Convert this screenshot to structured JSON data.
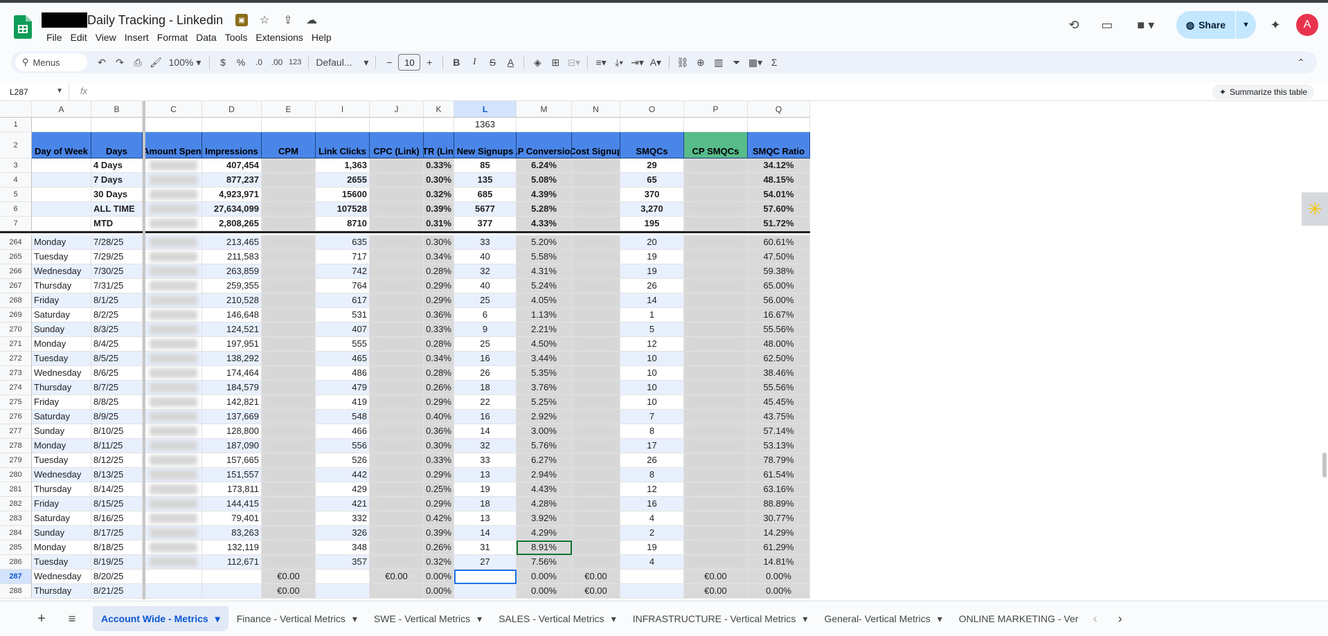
{
  "doc": {
    "title": "Daily Tracking - Linkedin"
  },
  "menu": [
    "File",
    "Edit",
    "View",
    "Insert",
    "Format",
    "Data",
    "Tools",
    "Extensions",
    "Help"
  ],
  "share": {
    "label": "Share"
  },
  "avatar": {
    "initial": "A"
  },
  "toolbar": {
    "search": "Menus",
    "zoom": "100%",
    "currency": "$",
    "percent": "%",
    "dec_dec": ".0",
    "dec_inc": ".00",
    "number_fmt": "123",
    "font": "Defaul...",
    "font_size": "10",
    "bold": "B",
    "italic": "I",
    "strike": "S",
    "textcolor": "A",
    "textformat": "A"
  },
  "formula": {
    "cell_ref": "L287",
    "fx": "fx",
    "summarize": "Summarize this table"
  },
  "columns": [
    "A",
    "B",
    "C",
    "D",
    "E",
    "I",
    "J",
    "K",
    "L",
    "M",
    "N",
    "O",
    "P",
    "Q"
  ],
  "frozen_rows": [
    {
      "num": "1",
      "cells": {
        "L": "1363"
      }
    },
    {
      "num": "2",
      "header": true,
      "cells": {
        "A": "Day of Week",
        "B": "Days",
        "C": "Amount Spent",
        "D": "Impressions",
        "E": "CPM",
        "I": "Link Clicks",
        "J": "CPC (Link)",
        "K": "CTR (Link)",
        "L": "New Signups",
        "M": "LP Conversion",
        "N": "Cost Signup",
        "O": "SMQCs",
        "P": "CP SMQCs",
        "Q": "SMQC Ratio"
      }
    },
    {
      "num": "3",
      "cells": {
        "B": "4 Days",
        "D": "407,454",
        "I": "1,363",
        "K": "0.33%",
        "L": "85",
        "M": "6.24%",
        "O": "29",
        "Q": "34.12%"
      }
    },
    {
      "num": "4",
      "cells": {
        "B": "7 Days",
        "D": "877,237",
        "I": "2655",
        "K": "0.30%",
        "L": "135",
        "M": "5.08%",
        "O": "65",
        "Q": "48.15%"
      }
    },
    {
      "num": "5",
      "cells": {
        "B": "30 Days",
        "D": "4,923,971",
        "I": "15600",
        "K": "0.32%",
        "L": "685",
        "M": "4.39%",
        "O": "370",
        "Q": "54.01%"
      }
    },
    {
      "num": "6",
      "cells": {
        "B": "ALL TIME",
        "D": "27,634,099",
        "I": "107528",
        "K": "0.39%",
        "L": "5677",
        "M": "5.28%",
        "O": "3,270",
        "Q": "57.60%"
      }
    },
    {
      "num": "7",
      "cells": {
        "B": "MTD",
        "D": "2,808,265",
        "I": "8710",
        "K": "0.31%",
        "L": "377",
        "M": "4.33%",
        "O": "195",
        "Q": "51.72%"
      }
    }
  ],
  "rows": [
    {
      "num": "264",
      "A": "Monday",
      "B": "7/28/25",
      "D": "213,465",
      "I": "635",
      "K": "0.30%",
      "L": "33",
      "M": "5.20%",
      "O": "20",
      "Q": "60.61%"
    },
    {
      "num": "265",
      "A": "Tuesday",
      "B": "7/29/25",
      "D": "211,583",
      "I": "717",
      "K": "0.34%",
      "L": "40",
      "M": "5.58%",
      "O": "19",
      "Q": "47.50%"
    },
    {
      "num": "266",
      "A": "Wednesday",
      "B": "7/30/25",
      "D": "263,859",
      "I": "742",
      "K": "0.28%",
      "L": "32",
      "M": "4.31%",
      "O": "19",
      "Q": "59.38%"
    },
    {
      "num": "267",
      "A": "Thursday",
      "B": "7/31/25",
      "D": "259,355",
      "I": "764",
      "K": "0.29%",
      "L": "40",
      "M": "5.24%",
      "O": "26",
      "Q": "65.00%"
    },
    {
      "num": "268",
      "A": "Friday",
      "B": "8/1/25",
      "D": "210,528",
      "I": "617",
      "K": "0.29%",
      "L": "25",
      "M": "4.05%",
      "O": "14",
      "Q": "56.00%"
    },
    {
      "num": "269",
      "A": "Saturday",
      "B": "8/2/25",
      "D": "146,648",
      "I": "531",
      "K": "0.36%",
      "L": "6",
      "M": "1.13%",
      "O": "1",
      "Q": "16.67%"
    },
    {
      "num": "270",
      "A": "Sunday",
      "B": "8/3/25",
      "D": "124,521",
      "I": "407",
      "K": "0.33%",
      "L": "9",
      "M": "2.21%",
      "O": "5",
      "Q": "55.56%"
    },
    {
      "num": "271",
      "A": "Monday",
      "B": "8/4/25",
      "D": "197,951",
      "I": "555",
      "K": "0.28%",
      "L": "25",
      "M": "4.50%",
      "O": "12",
      "Q": "48.00%"
    },
    {
      "num": "272",
      "A": "Tuesday",
      "B": "8/5/25",
      "D": "138,292",
      "I": "465",
      "K": "0.34%",
      "L": "16",
      "M": "3.44%",
      "O": "10",
      "Q": "62.50%"
    },
    {
      "num": "273",
      "A": "Wednesday",
      "B": "8/6/25",
      "D": "174,464",
      "I": "486",
      "K": "0.28%",
      "L": "26",
      "M": "5.35%",
      "O": "10",
      "Q": "38.46%"
    },
    {
      "num": "274",
      "A": "Thursday",
      "B": "8/7/25",
      "D": "184,579",
      "I": "479",
      "K": "0.26%",
      "L": "18",
      "M": "3.76%",
      "O": "10",
      "Q": "55.56%"
    },
    {
      "num": "275",
      "A": "Friday",
      "B": "8/8/25",
      "D": "142,821",
      "I": "419",
      "K": "0.29%",
      "L": "22",
      "M": "5.25%",
      "O": "10",
      "Q": "45.45%"
    },
    {
      "num": "276",
      "A": "Saturday",
      "B": "8/9/25",
      "D": "137,669",
      "I": "548",
      "K": "0.40%",
      "L": "16",
      "M": "2.92%",
      "O": "7",
      "Q": "43.75%"
    },
    {
      "num": "277",
      "A": "Sunday",
      "B": "8/10/25",
      "D": "128,800",
      "I": "466",
      "K": "0.36%",
      "L": "14",
      "M": "3.00%",
      "O": "8",
      "Q": "57.14%"
    },
    {
      "num": "278",
      "A": "Monday",
      "B": "8/11/25",
      "D": "187,090",
      "I": "556",
      "K": "0.30%",
      "L": "32",
      "M": "5.76%",
      "O": "17",
      "Q": "53.13%"
    },
    {
      "num": "279",
      "A": "Tuesday",
      "B": "8/12/25",
      "D": "157,665",
      "I": "526",
      "K": "0.33%",
      "L": "33",
      "M": "6.27%",
      "O": "26",
      "Q": "78.79%"
    },
    {
      "num": "280",
      "A": "Wednesday",
      "B": "8/13/25",
      "D": "151,557",
      "I": "442",
      "K": "0.29%",
      "L": "13",
      "M": "2.94%",
      "O": "8",
      "Q": "61.54%"
    },
    {
      "num": "281",
      "A": "Thursday",
      "B": "8/14/25",
      "D": "173,811",
      "I": "429",
      "K": "0.25%",
      "L": "19",
      "M": "4.43%",
      "O": "12",
      "Q": "63.16%"
    },
    {
      "num": "282",
      "A": "Friday",
      "B": "8/15/25",
      "D": "144,415",
      "I": "421",
      "K": "0.29%",
      "L": "18",
      "M": "4.28%",
      "O": "16",
      "Q": "88.89%"
    },
    {
      "num": "283",
      "A": "Saturday",
      "B": "8/16/25",
      "D": "79,401",
      "I": "332",
      "K": "0.42%",
      "L": "13",
      "M": "3.92%",
      "O": "4",
      "Q": "30.77%"
    },
    {
      "num": "284",
      "A": "Sunday",
      "B": "8/17/25",
      "D": "83,263",
      "I": "326",
      "K": "0.39%",
      "L": "14",
      "M": "4.29%",
      "O": "2",
      "Q": "14.29%"
    },
    {
      "num": "285",
      "A": "Monday",
      "B": "8/18/25",
      "D": "132,119",
      "I": "348",
      "K": "0.26%",
      "L": "31",
      "M": "8.91%",
      "O": "19",
      "Q": "61.29%"
    },
    {
      "num": "286",
      "A": "Tuesday",
      "B": "8/19/25",
      "D": "112,671",
      "I": "357",
      "K": "0.32%",
      "L": "27",
      "M": "7.56%",
      "O": "4",
      "Q": "14.81%"
    },
    {
      "num": "287",
      "A": "Wednesday",
      "B": "8/20/25",
      "E": "€0.00",
      "J": "€0.00",
      "K": "0.00%",
      "M": "0.00%",
      "N": "€0.00",
      "P": "€0.00",
      "Q": "0.00%"
    },
    {
      "num": "288",
      "A": "Thursday",
      "B": "8/21/25",
      "E": "€0.00",
      "K": "0.00%",
      "M": "0.00%",
      "N": "€0.00",
      "P": "€0.00",
      "Q": "0.00%"
    }
  ],
  "sheet_tabs": [
    "Account Wide - Metrics",
    "Finance - Vertical Metrics",
    "SWE - Vertical Metrics",
    "SALES - Vertical Metrics",
    "INFRASTRUCTURE - Vertical Metrics",
    "General- Vertical Metrics",
    "ONLINE MARKETING - Ver"
  ],
  "colors": {
    "header_blue": "#4a86e8",
    "header_green": "#57bb8a",
    "band": "#e8f0fe",
    "gray_col": "#d9d9d9",
    "accent": "#0b57d0"
  }
}
